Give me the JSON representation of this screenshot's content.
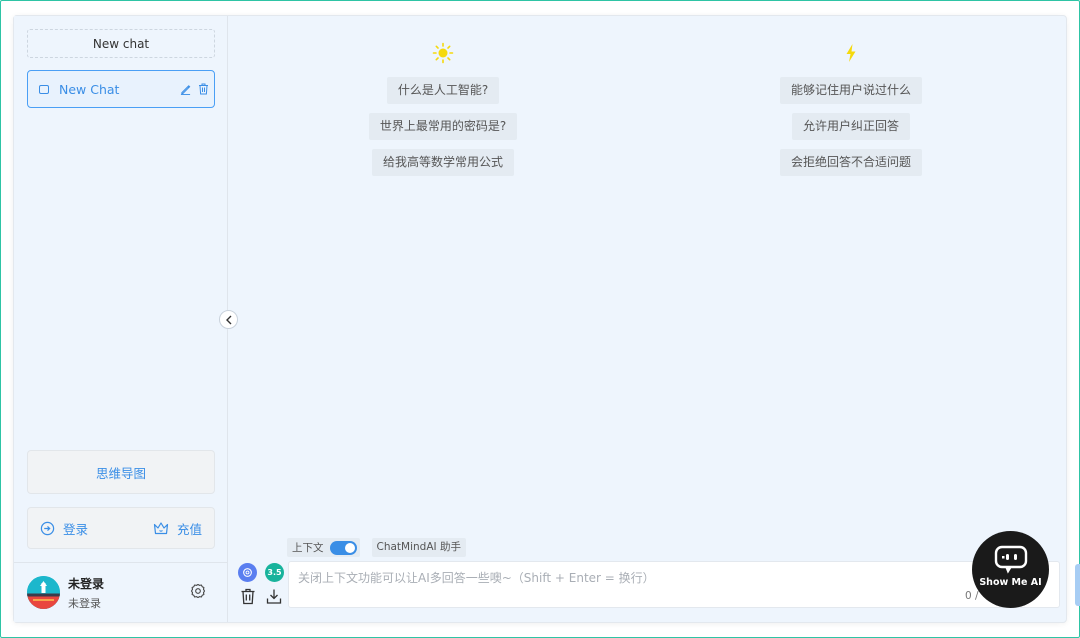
{
  "sidebar": {
    "new_chat_button": "New chat",
    "chat_items": [
      {
        "label": "New Chat",
        "active": true
      }
    ],
    "mind_map_button": "思维导图",
    "login_label": "登录",
    "recharge_label": "充值",
    "user": {
      "name": "未登录",
      "status": "未登录"
    }
  },
  "suggestions": {
    "left": {
      "icon": "sun-icon",
      "items": [
        "什么是人工智能?",
        "世界上最常用的密码是?",
        "给我高等数学常用公式"
      ]
    },
    "right": {
      "icon": "lightning-icon",
      "items": [
        "能够记住用户说过什么",
        "允许用户纠正回答",
        "会拒绝回答不合适问题"
      ]
    }
  },
  "composer": {
    "context_label": "上下文",
    "context_enabled": true,
    "assistant_label": "ChatMindAI 助手",
    "model_badge": "3.5",
    "placeholder": "关闭上下文功能可以让AI多回答一些噢~（Shift + Enter = 换行）",
    "char_count": "0 /"
  },
  "badge": {
    "text": "Show Me AI"
  },
  "colors": {
    "accent": "#3a8ee6",
    "frame": "#2ec4a5",
    "background": "#eef5fd"
  }
}
